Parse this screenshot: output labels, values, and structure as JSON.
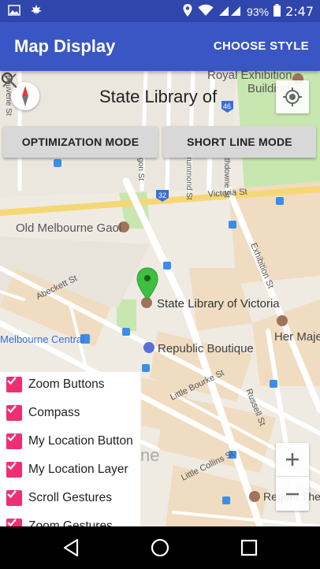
{
  "status_bar": {
    "battery": "93%",
    "time": "2:47"
  },
  "app_bar": {
    "title": "Map Display",
    "action_label": "CHOOSE STYLE"
  },
  "search": {
    "value": "State Library of"
  },
  "modes": {
    "optimization_label": "OPTIMIZATION MODE",
    "short_line_label": "SHORT LINE MODE"
  },
  "map": {
    "labels": {
      "royal_exhibition": "Royal Exhibition",
      "building": "Building",
      "bouverie_st": "Bouverie St",
      "lygon_st": "Lygon St",
      "drummond_st": "Drummond St",
      "rathdowne_st": "Rathdowne St",
      "route_46": "46",
      "route_32": "32",
      "victoria_st": "Victoria St",
      "old_melbourne_gaol": "Old Melbourne Gaol",
      "exhibition_st": "Exhibition St",
      "abeckett_st": "Abeckett St",
      "state_library": "State Library of Victoria",
      "melbourne_central": "Melbourne Central",
      "her_majesty": "Her Maje",
      "republic_boutique": "Republic Boutique",
      "little_bourke_st": "Little Bourke St",
      "russell_st": "Russell St",
      "little_collins_st": "Little Collins St",
      "regent_theatre": "Regent The",
      "faded_ne": "ne"
    }
  },
  "options": [
    {
      "label": "Zoom Buttons",
      "checked": true
    },
    {
      "label": "Compass",
      "checked": true
    },
    {
      "label": "My Location Button",
      "checked": true
    },
    {
      "label": "My Location Layer",
      "checked": true
    },
    {
      "label": "Scroll Gestures",
      "checked": true
    },
    {
      "label": "Zoom Gestures",
      "checked": true
    }
  ],
  "colors": {
    "app_bar": "#3a55c4",
    "status_bar": "#2f46ad",
    "checkbox": "#ef2f74",
    "marker": "#3fbf3f"
  }
}
